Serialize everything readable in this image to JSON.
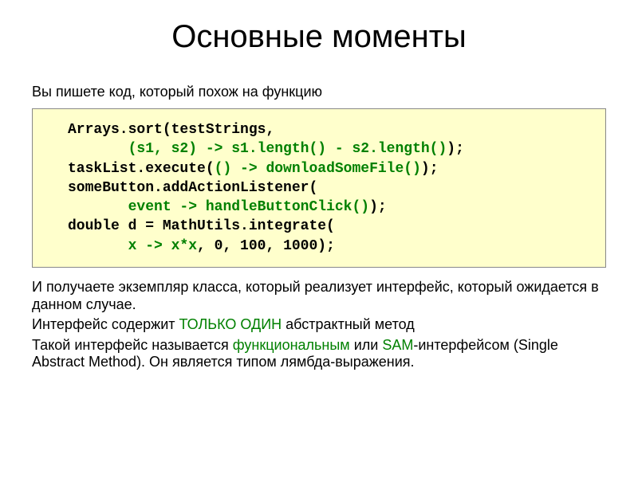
{
  "title": "Основные моменты",
  "lead": "Вы пишете код, который похож на функцию",
  "code": {
    "l1a": "Arrays.sort(testStrings,",
    "l2pad": "       ",
    "l2a": "(s1, s2) -> s1.length() - s2.length()",
    "l2b": ");",
    "l3a": "taskList.execute(",
    "l3b": "() -> downloadSomeFile()",
    "l3c": ");",
    "l4a": "someButton.addActionListener(",
    "l5pad": "       ",
    "l5a": "event -> handleButtonClick()",
    "l5b": ");",
    "l6a": "double d = MathUtils.integrate(",
    "l7pad": "       ",
    "l7a": "x -> x*x",
    "l7b": ", 0, 100, 1000);"
  },
  "para1": "И получаете экземпляр класса, который реализует интерфейс, который ожидается в данном случае.",
  "para2a": "Интерфейс содержит ",
  "para2em": "ТОЛЬКО ОДИН",
  "para2b": " абстрактный метод",
  "para3a": "Такой интерфейс называется ",
  "para3em1": "функциональным",
  "para3b": " или ",
  "para3em2": "SAM",
  "para3c": "-интерфейсом (Single Abstract Method). Он является типом лямбда-выражения."
}
